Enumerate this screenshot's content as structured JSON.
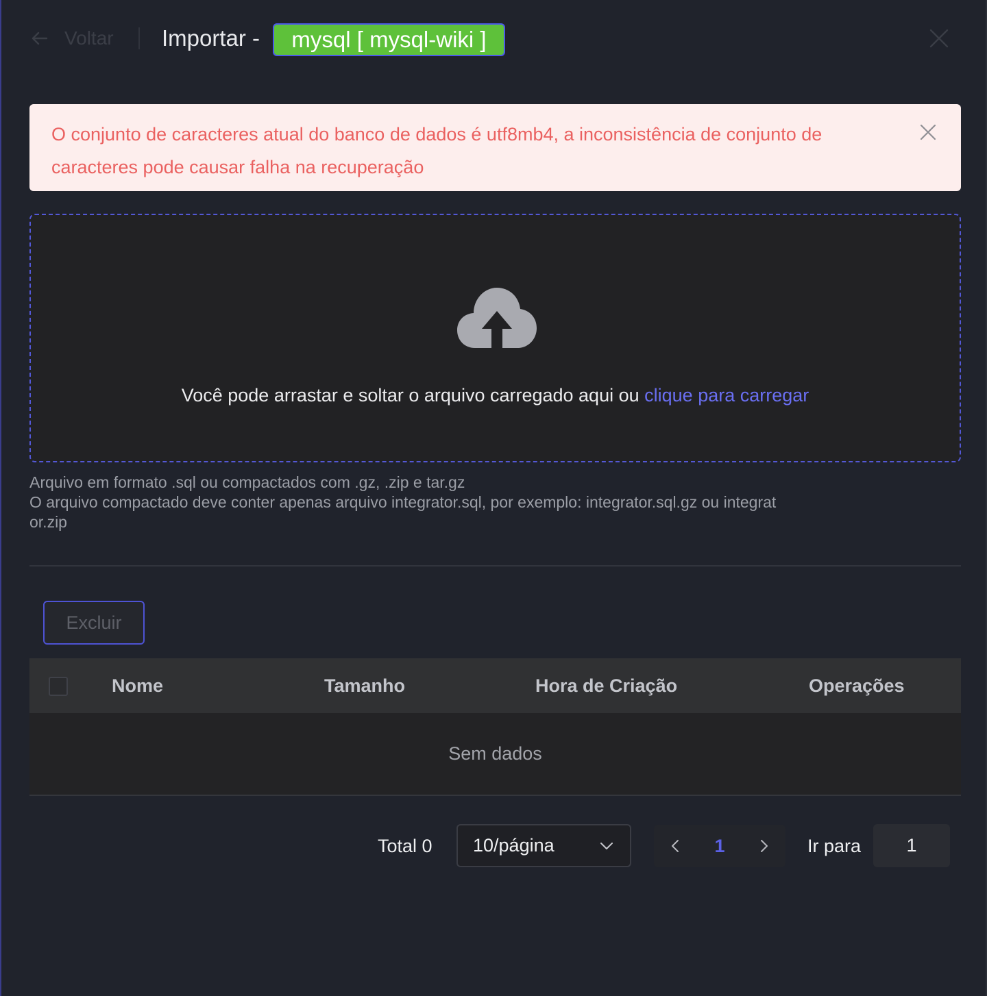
{
  "header": {
    "back_label": "Voltar",
    "title": "Importar -",
    "db_tag": "mysql [ mysql-wiki ]"
  },
  "alert": {
    "message": "O conjunto de caracteres atual do banco de dados é utf8mb4, a inconsistência de conjunto de caracteres pode causar falha na recuperação"
  },
  "upload": {
    "text": "Você pode arrastar e soltar o arquivo carregado aqui ou",
    "link": "clique para carregar"
  },
  "hint": {
    "line1": "Arquivo em formato .sql ou compactados com .gz, .zip e tar.gz",
    "line2": "O arquivo compactado deve conter apenas arquivo integrator.sql, por exemplo: integrator.sql.gz ou integrator.zip"
  },
  "toolbar": {
    "delete_label": "Excluir"
  },
  "table": {
    "columns": [
      "Nome",
      "Tamanho",
      "Hora de Criação",
      "Operações"
    ],
    "empty_text": "Sem dados"
  },
  "pagination": {
    "total_label": "Total 0",
    "page_size": "10/página",
    "current_page": "1",
    "goto_label": "Ir para",
    "goto_value": "1"
  },
  "colors": {
    "background": "#20232c",
    "tag_green": "#5ec13a",
    "alert_bg": "#fdeeed",
    "alert_text": "#ea6160",
    "accent": "#5b61e6"
  },
  "icons": [
    "arrow-left-icon",
    "close-icon",
    "cloud-upload-icon",
    "chevron-down-icon",
    "chevron-left-icon",
    "chevron-right-icon"
  ]
}
